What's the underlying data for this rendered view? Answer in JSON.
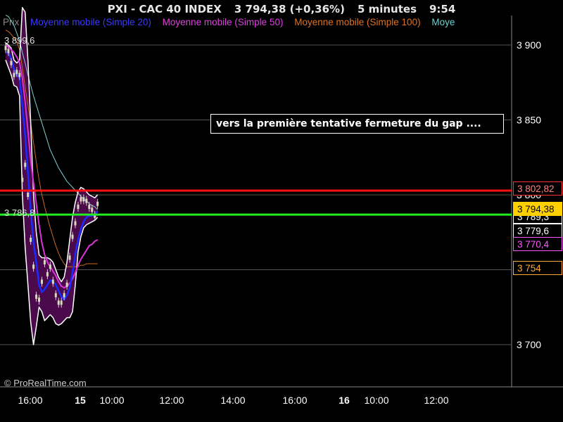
{
  "header": {
    "instrument": "PXI - CAC 40 INDEX",
    "last_quote": "3 794,38 (+0,36%)",
    "timeframe": "5 minutes",
    "time": "9:54"
  },
  "legend": [
    {
      "label": "Prix",
      "color": "#888888"
    },
    {
      "label": "Moyenne mobile (Simple 20)",
      "color": "#3a3aff"
    },
    {
      "label": "Moyenne mobile (Simple 50)",
      "color": "#e040e0"
    },
    {
      "label": "Moyenne mobile (Simple 100)",
      "color": "#e07020"
    },
    {
      "label": "Moye",
      "color": "#70d0d0"
    }
  ],
  "annotation": "vers la première tentative fermeture du gap ....",
  "credit": "© ProRealTime.com",
  "colors": {
    "band_fill": "#4b0a4b",
    "band_edge": "#ffffff",
    "resistance_line": "#ff1010",
    "support_line": "#22ee22",
    "sma20": "#1a2cff",
    "sma50": "#dd33dd",
    "sma100": "#cc6a20",
    "sma200": "#7fd0d0",
    "candle": "#d8d8c0",
    "grid": "#555555"
  },
  "chart_data": {
    "type": "line",
    "xlabel": "",
    "ylabel": "",
    "ylim": [
      3667,
      3925
    ],
    "y_ticks": [
      3700,
      3750,
      3800,
      3850,
      3900
    ],
    "y_tick_labels": [
      "3 700",
      "3 750",
      "3 800",
      "3 850",
      "3 900"
    ],
    "x_tick_labels": [
      "16:00",
      "15",
      "10:00",
      "12:00",
      "14:00",
      "16:00",
      "16",
      "10:00",
      "12:00"
    ],
    "x_tick_bold": [
      false,
      true,
      false,
      false,
      false,
      false,
      true,
      false,
      false
    ],
    "grid": true,
    "horizontal_lines": [
      {
        "name": "resistance",
        "value": 3802.82
      },
      {
        "name": "support",
        "value": 3786.8
      }
    ],
    "price_labels": [
      {
        "text": "3 899,6",
        "value": 3899.6
      },
      {
        "text": "3 786,8",
        "value": 3786.8
      }
    ],
    "axis_boxes": [
      {
        "text": "3 802,82",
        "value": 3802.82,
        "bg": "#000000",
        "fg": "#ff8080",
        "border": "#ff3030"
      },
      {
        "text": "3 794,38",
        "value": 3794.38,
        "bg": "#ffd000",
        "fg": "#000000",
        "border": "#ffd000"
      },
      {
        "text": "3 789,3",
        "value": 3789.3,
        "bg": "#000000",
        "fg": "#ffffff",
        "border": "#ffffff"
      },
      {
        "text": "3 779,6",
        "value": 3779.6,
        "bg": "#000000",
        "fg": "#ffffff",
        "border": "#ffffff"
      },
      {
        "text": "3 770,4",
        "value": 3770.4,
        "bg": "#000000",
        "fg": "#ff55ff",
        "border": "#ff55ff"
      },
      {
        "text": "3 754",
        "value": 3754,
        "bg": "#000000",
        "fg": "#ffaa33",
        "border": "#ffaa33"
      }
    ],
    "x": [
      0,
      4,
      8,
      12,
      16,
      20,
      24,
      28,
      32,
      36,
      40,
      44,
      48,
      52,
      56,
      60,
      64,
      68,
      72,
      76,
      80,
      84,
      88,
      92,
      96,
      100,
      104,
      108,
      112,
      116,
      120,
      124,
      128,
      132
    ],
    "price": [
      3898,
      3896,
      3888,
      3880,
      3882,
      3880,
      3810,
      3820,
      3800,
      3770,
      3752,
      3732,
      3730,
      3742,
      3755,
      3747,
      3752,
      3742,
      3733,
      3728,
      3728,
      3733,
      3740,
      3758,
      3772,
      3781,
      3792,
      3797,
      3797,
      3796,
      3792,
      3790,
      3786,
      3794
    ],
    "series": [
      {
        "name": "Moyenne mobile (Simple 20)",
        "key": "sma20",
        "values": [
          3895,
          3895,
          3891,
          3884,
          3880,
          3878,
          3860,
          3840,
          3815,
          3790,
          3768,
          3755,
          3740,
          3735,
          3737,
          3740,
          3743,
          3742,
          3740,
          3736,
          3732,
          3730,
          3733,
          3738,
          3748,
          3760,
          3770,
          3777,
          3782,
          3785,
          3786,
          3786,
          3787,
          3789
        ]
      },
      {
        "name": "Moyenne mobile (Simple 50)",
        "key": "sma50",
        "values": [
          3900,
          3899,
          3897,
          3895,
          3892,
          3888,
          3878,
          3862,
          3843,
          3823,
          3808,
          3794,
          3780,
          3768,
          3760,
          3755,
          3752,
          3749,
          3746,
          3742,
          3739,
          3738,
          3739,
          3741,
          3744,
          3748,
          3753,
          3757,
          3760,
          3763,
          3766,
          3767,
          3769,
          3770
        ]
      },
      {
        "name": "Moyenne mobile (Simple 100)",
        "key": "sma100",
        "values": [
          3910,
          3909,
          3907,
          3905,
          3902,
          3897,
          3885,
          3872,
          3860,
          3848,
          3835,
          3822,
          3810,
          3800,
          3792,
          3785,
          3778,
          3772,
          3766,
          3761,
          3757,
          3754,
          3752,
          3752,
          3752,
          3752,
          3752,
          3753,
          3753,
          3754,
          3754,
          3754,
          3754,
          3754
        ]
      },
      {
        "name": "Moye",
        "key": "sma200",
        "values": [
          3920,
          3919,
          3916,
          3913,
          3908,
          3903,
          3895,
          3888,
          3880,
          3873,
          3866,
          3860,
          3854,
          3848,
          3842,
          3836,
          3830,
          3826,
          3822,
          3818,
          3815,
          3812,
          3809,
          3807,
          3805,
          3803,
          3801,
          3799,
          3797,
          3796,
          3794,
          3793,
          3792,
          3790
        ]
      },
      {
        "name": "upper band",
        "key": "upper",
        "values": [
          3901,
          3900,
          3898,
          3890,
          3888,
          3890,
          3925,
          3922,
          3890,
          3848,
          3800,
          3775,
          3760,
          3758,
          3758,
          3758,
          3757,
          3755,
          3750,
          3745,
          3742,
          3745,
          3755,
          3770,
          3785,
          3795,
          3802,
          3805,
          3804,
          3802,
          3800,
          3799,
          3798,
          3800
        ]
      },
      {
        "name": "lower band",
        "key": "lower",
        "values": [
          3890,
          3885,
          3880,
          3873,
          3872,
          3866,
          3800,
          3765,
          3740,
          3715,
          3700,
          3712,
          3725,
          3722,
          3716,
          3718,
          3720,
          3718,
          3714,
          3713,
          3714,
          3716,
          3718,
          3718,
          3722,
          3740,
          3762,
          3772,
          3778,
          3780,
          3781,
          3782,
          3783,
          3785
        ]
      }
    ]
  }
}
